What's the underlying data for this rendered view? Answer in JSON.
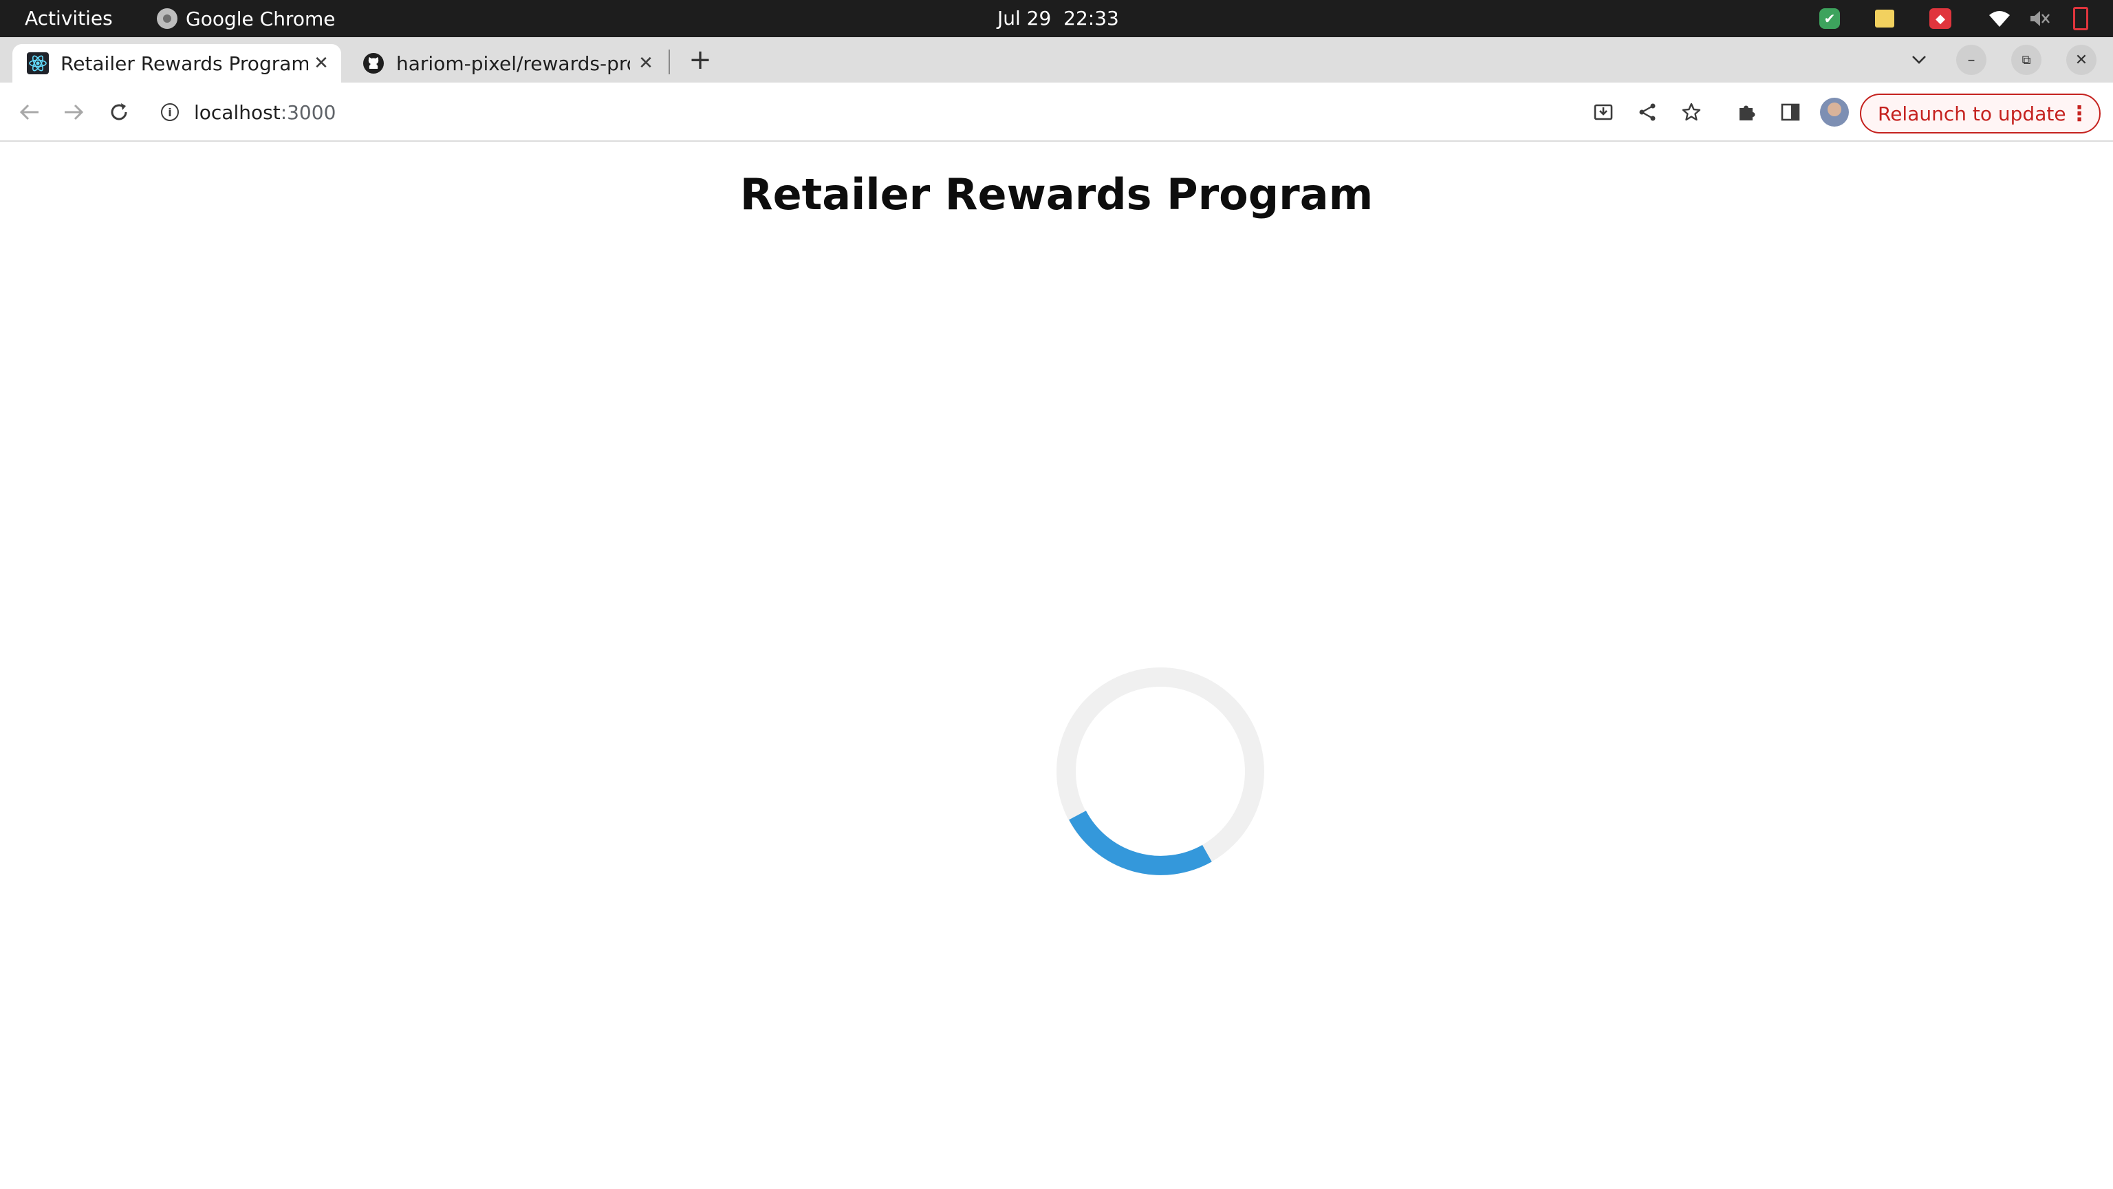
{
  "system_bar": {
    "activities_label": "Activities",
    "app_name": "Google Chrome",
    "date": "Jul 29",
    "time": "22:33",
    "tray_icons": [
      "shield-check-icon",
      "sticky-note-icon",
      "anydesk-icon",
      "wifi-icon",
      "volume-muted-icon",
      "battery-low-icon"
    ]
  },
  "tabs": [
    {
      "title": "Retailer Rewards Program",
      "favicon": "react-icon",
      "active": true
    },
    {
      "title": "hariom-pixel/rewards-pro",
      "favicon": "github-icon",
      "active": false
    }
  ],
  "toolbar": {
    "url_host": "localhost",
    "url_port": ":3000",
    "relaunch_label": "Relaunch to update"
  },
  "page": {
    "title": "Retailer Rewards Program",
    "loading": true
  },
  "colors": {
    "spinner_track": "#f0f0f0",
    "spinner_arc": "#3498db",
    "relaunch_red": "#c5221f"
  }
}
